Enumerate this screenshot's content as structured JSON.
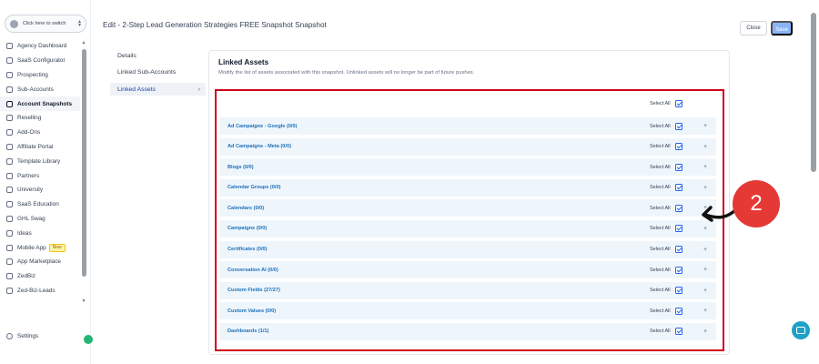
{
  "sidebar": {
    "switcher_label": "Click here to switch",
    "items": [
      {
        "label": "Agency Dashboard",
        "icon": "dashboard-icon"
      },
      {
        "label": "SaaS Configurator",
        "icon": "saas-icon"
      },
      {
        "label": "Prospecting",
        "icon": "prospecting-icon"
      },
      {
        "label": "Sub-Accounts",
        "icon": "sub-accounts-icon"
      },
      {
        "label": "Account Snapshots",
        "icon": "snapshot-icon",
        "active": true
      },
      {
        "label": "Reselling",
        "icon": "reselling-icon"
      },
      {
        "label": "Add-Ons",
        "icon": "add-ons-icon"
      },
      {
        "label": "Affiliate Portal",
        "icon": "affiliate-icon"
      },
      {
        "label": "Template Library",
        "icon": "template-icon"
      },
      {
        "label": "Partners",
        "icon": "partners-icon"
      },
      {
        "label": "University",
        "icon": "university-icon"
      },
      {
        "label": "SaaS Education",
        "icon": "education-icon"
      },
      {
        "label": "GHL Swag",
        "icon": "swag-icon"
      },
      {
        "label": "Ideas",
        "icon": "ideas-icon"
      },
      {
        "label": "Mobile App",
        "icon": "mobile-icon",
        "badge": "New"
      },
      {
        "label": "App Marketplace",
        "icon": "marketplace-icon"
      },
      {
        "label": "ZedBiz",
        "icon": "zedbiz-icon"
      },
      {
        "label": "Zed-Biz-Leads",
        "icon": "leads-icon"
      },
      {
        "label": "Zed-Biz-Leads",
        "icon": "leads-icon"
      }
    ],
    "settings_label": "Settings"
  },
  "header": {
    "title": "Edit - 2-Step Lead Generation Strategies FREE Snapshot Snapshot",
    "close_label": "Close",
    "save_label": "Save"
  },
  "tabs": [
    {
      "label": "Details"
    },
    {
      "label": "Linked Sub-Accounts"
    },
    {
      "label": "Linked Assets",
      "active": true
    }
  ],
  "linked_assets": {
    "title": "Linked Assets",
    "description": "Modify the list of assets associated with this snapshot. Unlinked assets will no longer be part of future pushes.",
    "select_all_label": "Select All",
    "rows": [
      {
        "name": "Ad Campaigns - Google (0/0)"
      },
      {
        "name": "Ad Campaigns - Meta (0/0)"
      },
      {
        "name": "Blogs (0/0)"
      },
      {
        "name": "Calendar Groups (0/0)"
      },
      {
        "name": "Calendars (0/0)"
      },
      {
        "name": "Campaigns (0/0)"
      },
      {
        "name": "Certificates (0/0)"
      },
      {
        "name": "Conversation AI (0/0)"
      },
      {
        "name": "Custom Fields (27/27)"
      },
      {
        "name": "Custom Values (0/0)"
      },
      {
        "name": "Dashboards (1/1)"
      }
    ],
    "row_select_label": "Select All",
    "expand_symbol": "+"
  },
  "annotation": {
    "number": "2",
    "color": "#e53935"
  },
  "colors": {
    "accent": "#2563eb",
    "highlight_border": "#d0021b",
    "save_button": "#8ab4f8"
  }
}
